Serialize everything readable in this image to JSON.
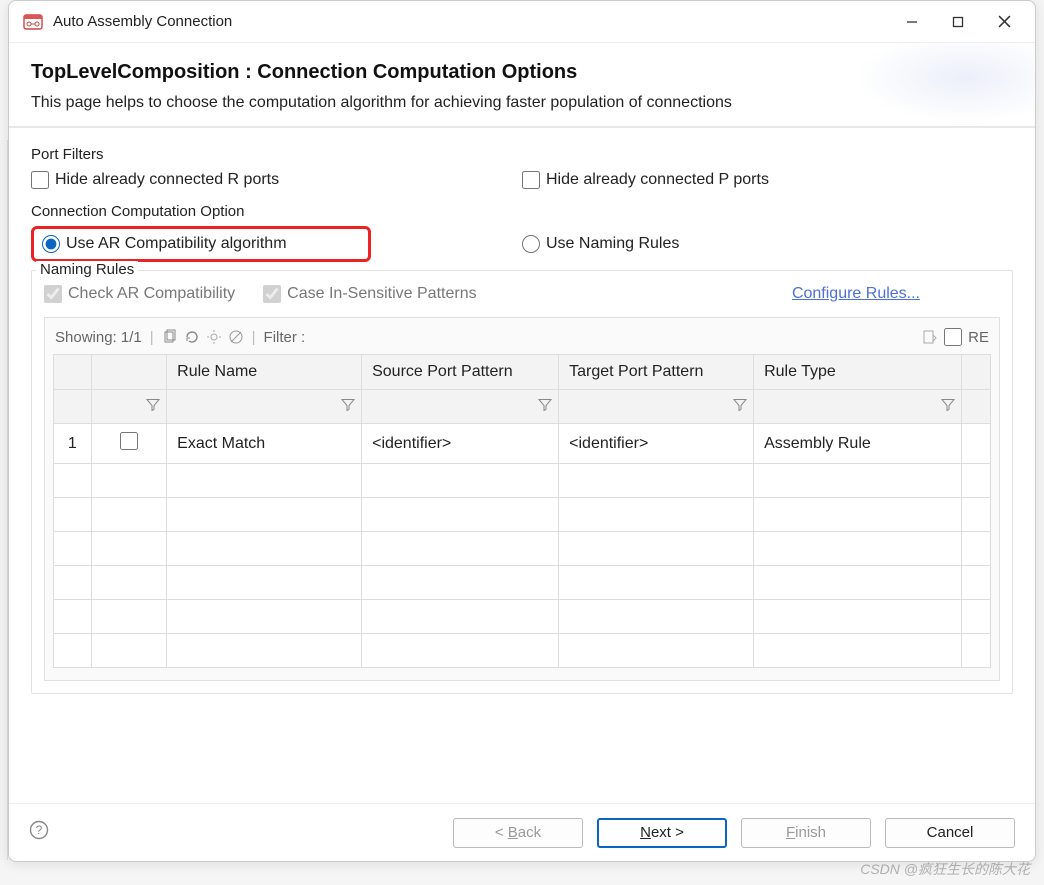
{
  "window": {
    "title": "Auto Assembly Connection"
  },
  "header": {
    "title": "TopLevelComposition : Connection Computation Options",
    "subtitle": "This page helps to choose the computation algorithm for achieving faster population of connections"
  },
  "portFilters": {
    "legend": "Port Filters",
    "hideR": "Hide already connected R ports",
    "hideP": "Hide already connected P ports"
  },
  "computationOption": {
    "legend": "Connection Computation Option",
    "useAR": "Use AR Compatibility algorithm",
    "useNaming": "Use Naming Rules"
  },
  "namingRules": {
    "legend": "Naming Rules",
    "checkAR": "Check AR Compatibility",
    "caseInsensitive": "Case In-Sensitive Patterns",
    "configure": "Configure Rules..."
  },
  "toolbar": {
    "showing": "Showing: 1/1",
    "filterLabel": "Filter :",
    "re": "RE"
  },
  "table": {
    "headers": {
      "ruleName": "Rule Name",
      "sourcePattern": "Source Port Pattern",
      "targetPattern": "Target Port Pattern",
      "ruleType": "Rule Type"
    },
    "rows": [
      {
        "num": "1",
        "checked": false,
        "ruleName": "Exact Match",
        "source": "<identifier>",
        "target": "<identifier>",
        "type": "Assembly Rule"
      }
    ]
  },
  "footer": {
    "back": "< Back",
    "next": "Next >",
    "finish": "Finish",
    "cancel": "Cancel"
  },
  "watermark": "CSDN @疯狂生长的陈大花"
}
